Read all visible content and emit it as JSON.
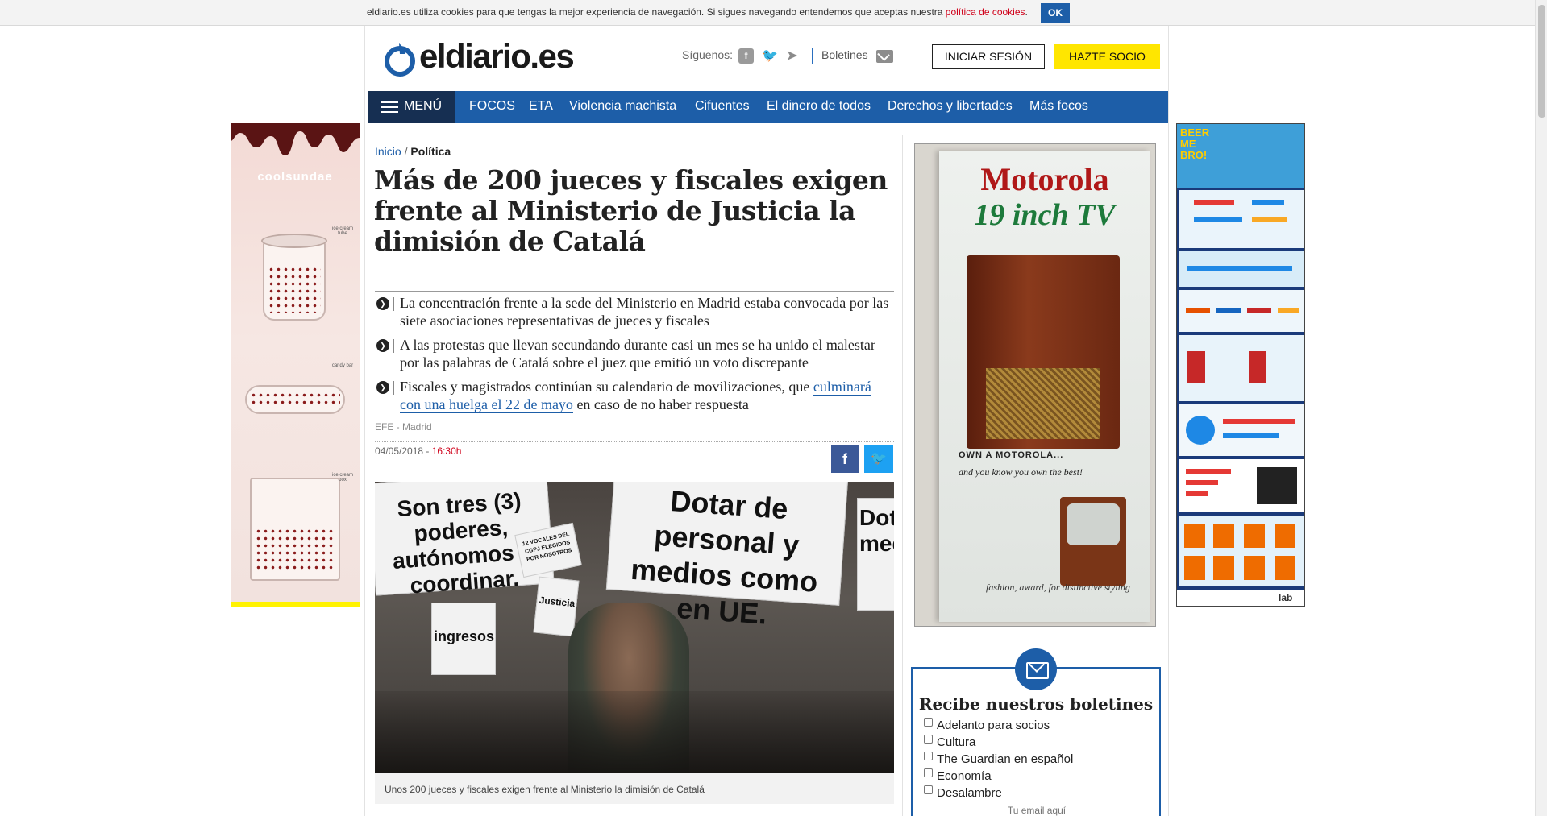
{
  "cookie": {
    "text": "eldiario.es utiliza cookies para que tengas la mejor experiencia de navegación. Si sigues navegando entendemos que aceptas nuestra ",
    "link": "política de cookies",
    "period": ".",
    "ok": "OK"
  },
  "header": {
    "logo": "eldiario.es",
    "follow_label": "Síguenos:",
    "boletines": "Boletines",
    "login": "INICIAR SESIÓN",
    "subscribe": "HAZTE SOCIO"
  },
  "nav": {
    "menu": "MENÚ",
    "items": [
      "FOCOS",
      "ETA",
      "Violencia machista",
      "Cifuentes",
      "El dinero de todos",
      "Derechos y libertades",
      "Más focos"
    ]
  },
  "breadcrumb": {
    "home": "Inicio",
    "sep": "/",
    "current": "Política"
  },
  "article": {
    "headline": "Más de 200 jueces y fiscales exigen frente al Ministerio de Justicia la dimisión de Catalá",
    "bullets": [
      {
        "text": "La concentración frente a la sede del Ministerio en Madrid estaba convocada por las siete asociaciones representativas de jueces y fiscales"
      },
      {
        "text": "A las protestas que llevan secundando durante casi un mes se ha unido el malestar por las palabras de Catalá sobre el juez que emitió un voto discrepante"
      },
      {
        "text_before": "Fiscales y magistrados continúan su calendario de movilizaciones, que ",
        "link": "culminará con una huelga el 22 de mayo",
        "text_after": " en caso de no haber respuesta"
      }
    ],
    "byline": "EFE - Madrid",
    "date": "04/05/2018 - ",
    "time": "16:30h",
    "photo_signs": [
      "Son tres (3) poderes, autónomos a coordinar.",
      "Dotar de personal y medios como en UE.",
      "12 VOCALES DEL CGPJ ELEGIDOS POR NOSOTROS",
      "Dota medi",
      "ingresos",
      "Justicia"
    ],
    "caption": "Unos 200 jueces y fiscales exigen frente al Ministerio la dimisión de Catalá"
  },
  "ads": {
    "left_brand": "coolsundae",
    "left_labels": [
      "ice cream tube",
      "candy bar",
      "ice cream box"
    ],
    "motorola_title": "Motorola",
    "motorola_sub": "19 inch TV",
    "motorola_own": "OWN A MOTOROLA...",
    "motorola_tag": "and you know you own the best!",
    "motorola_fashion": "fashion, award, for distinctive styling",
    "right_title": "BEER ME BRO!",
    "right_lab": "lab"
  },
  "newsletter": {
    "title": "Recibe nuestros boletines",
    "options": [
      "Adelanto para socios",
      "Cultura",
      "The Guardian en español",
      "Economía",
      "Desalambre"
    ],
    "email_placeholder": "Tu email aquí"
  },
  "colors": {
    "brand_blue": "#1d5ea8",
    "menu_dark": "#162f52",
    "subscribe_yellow": "#ffe600",
    "accent_red": "#d0021b"
  }
}
